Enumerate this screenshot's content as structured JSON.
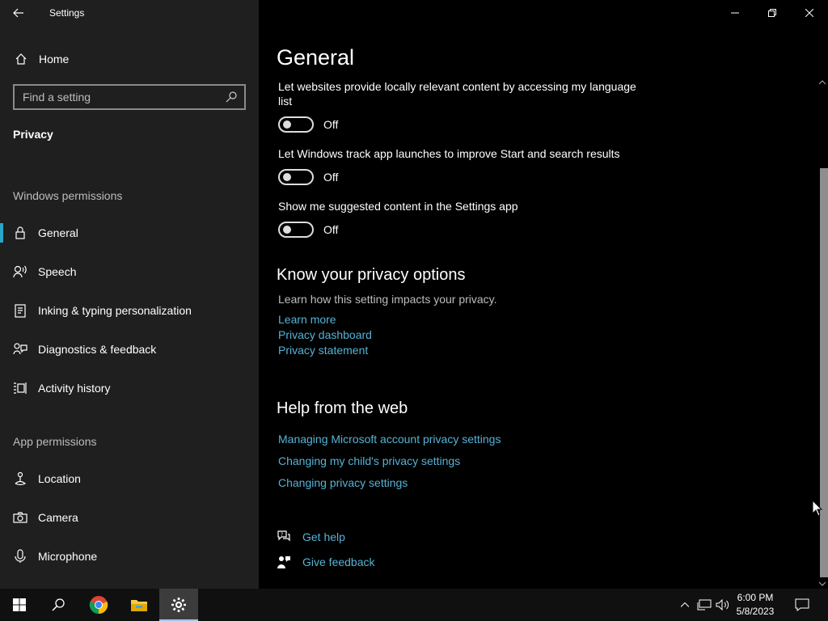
{
  "window": {
    "title": "Settings"
  },
  "sidebar": {
    "home_label": "Home",
    "search_placeholder": "Find a setting",
    "breadcrumb": "Privacy",
    "windows_permissions_title": "Windows permissions",
    "windows_permissions": [
      {
        "label": "General",
        "icon": "lock-icon",
        "active": true
      },
      {
        "label": "Speech",
        "icon": "speech-icon"
      },
      {
        "label": "Inking & typing personalization",
        "icon": "clipboard-pen-icon"
      },
      {
        "label": "Diagnostics & feedback",
        "icon": "feedback-icon"
      },
      {
        "label": "Activity history",
        "icon": "activity-icon"
      }
    ],
    "app_permissions_title": "App permissions",
    "app_permissions": [
      {
        "label": "Location",
        "icon": "location-icon"
      },
      {
        "label": "Camera",
        "icon": "camera-icon"
      },
      {
        "label": "Microphone",
        "icon": "microphone-icon"
      }
    ]
  },
  "main": {
    "title": "General",
    "settings": [
      {
        "text": "Let websites provide locally relevant content by accessing my language list",
        "state": "Off"
      },
      {
        "text": "Let Windows track app launches to improve Start and search results",
        "state": "Off"
      },
      {
        "text": "Show me suggested content in the Settings app",
        "state": "Off"
      }
    ],
    "privacy_options": {
      "title": "Know your privacy options",
      "description": "Learn how this setting impacts your privacy.",
      "links": [
        "Learn more",
        "Privacy dashboard",
        "Privacy statement"
      ]
    },
    "help_web": {
      "title": "Help from the web",
      "links": [
        "Managing Microsoft account privacy settings",
        "Changing my child's privacy settings",
        "Changing privacy settings"
      ]
    },
    "get_help": "Get help",
    "give_feedback": "Give feedback"
  },
  "taskbar": {
    "time": "6:00 PM",
    "date": "5/8/2023",
    "apps": [
      "start-icon",
      "search-icon",
      "chrome-icon",
      "file-explorer-icon",
      "settings-icon"
    ]
  },
  "colors": {
    "accent": "#2aa6c9",
    "link": "#55b3d6",
    "sidebar_bg": "#1f1f1f"
  }
}
